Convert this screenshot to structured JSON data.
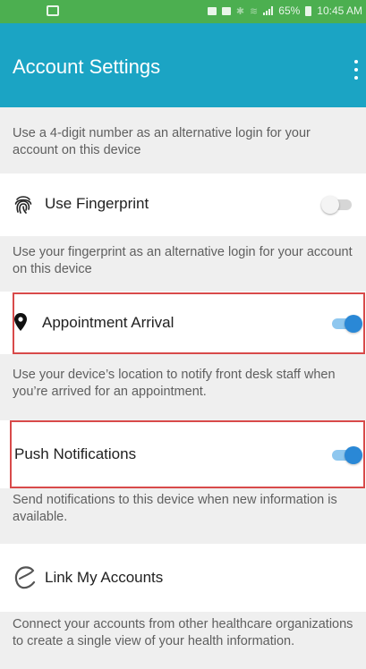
{
  "status_bar": {
    "battery": "65%",
    "time": "10:45 AM"
  },
  "app_bar": {
    "title": "Account Settings",
    "menu_icon": "more-vert-icon"
  },
  "pin_section": {
    "description": "Use a 4-digit number as an alternative login for your account on this device"
  },
  "fingerprint": {
    "label": "Use Fingerprint",
    "icon": "fingerprint-icon",
    "enabled": false,
    "description": "Use your fingerprint as an alternative login for your account on this device"
  },
  "appointment_arrival": {
    "label": "Appointment Arrival",
    "icon": "location-pin-icon",
    "enabled": true,
    "description": "Use your device’s location to notify front desk staff when you’re arrived for an appointment."
  },
  "push_notifications": {
    "label": "Push Notifications",
    "enabled": true,
    "description": "Send notifications to this device when new information is available."
  },
  "link_accounts": {
    "label": "Link My Accounts",
    "icon": "e-logo-icon",
    "description": "Connect your accounts from other healthcare organizations to create a single view of your health information."
  },
  "colors": {
    "status_bar": "#4caf50",
    "app_bar": "#1ba4c4",
    "toggle_on": "#2a88d6",
    "highlight": "#d84a4a"
  }
}
